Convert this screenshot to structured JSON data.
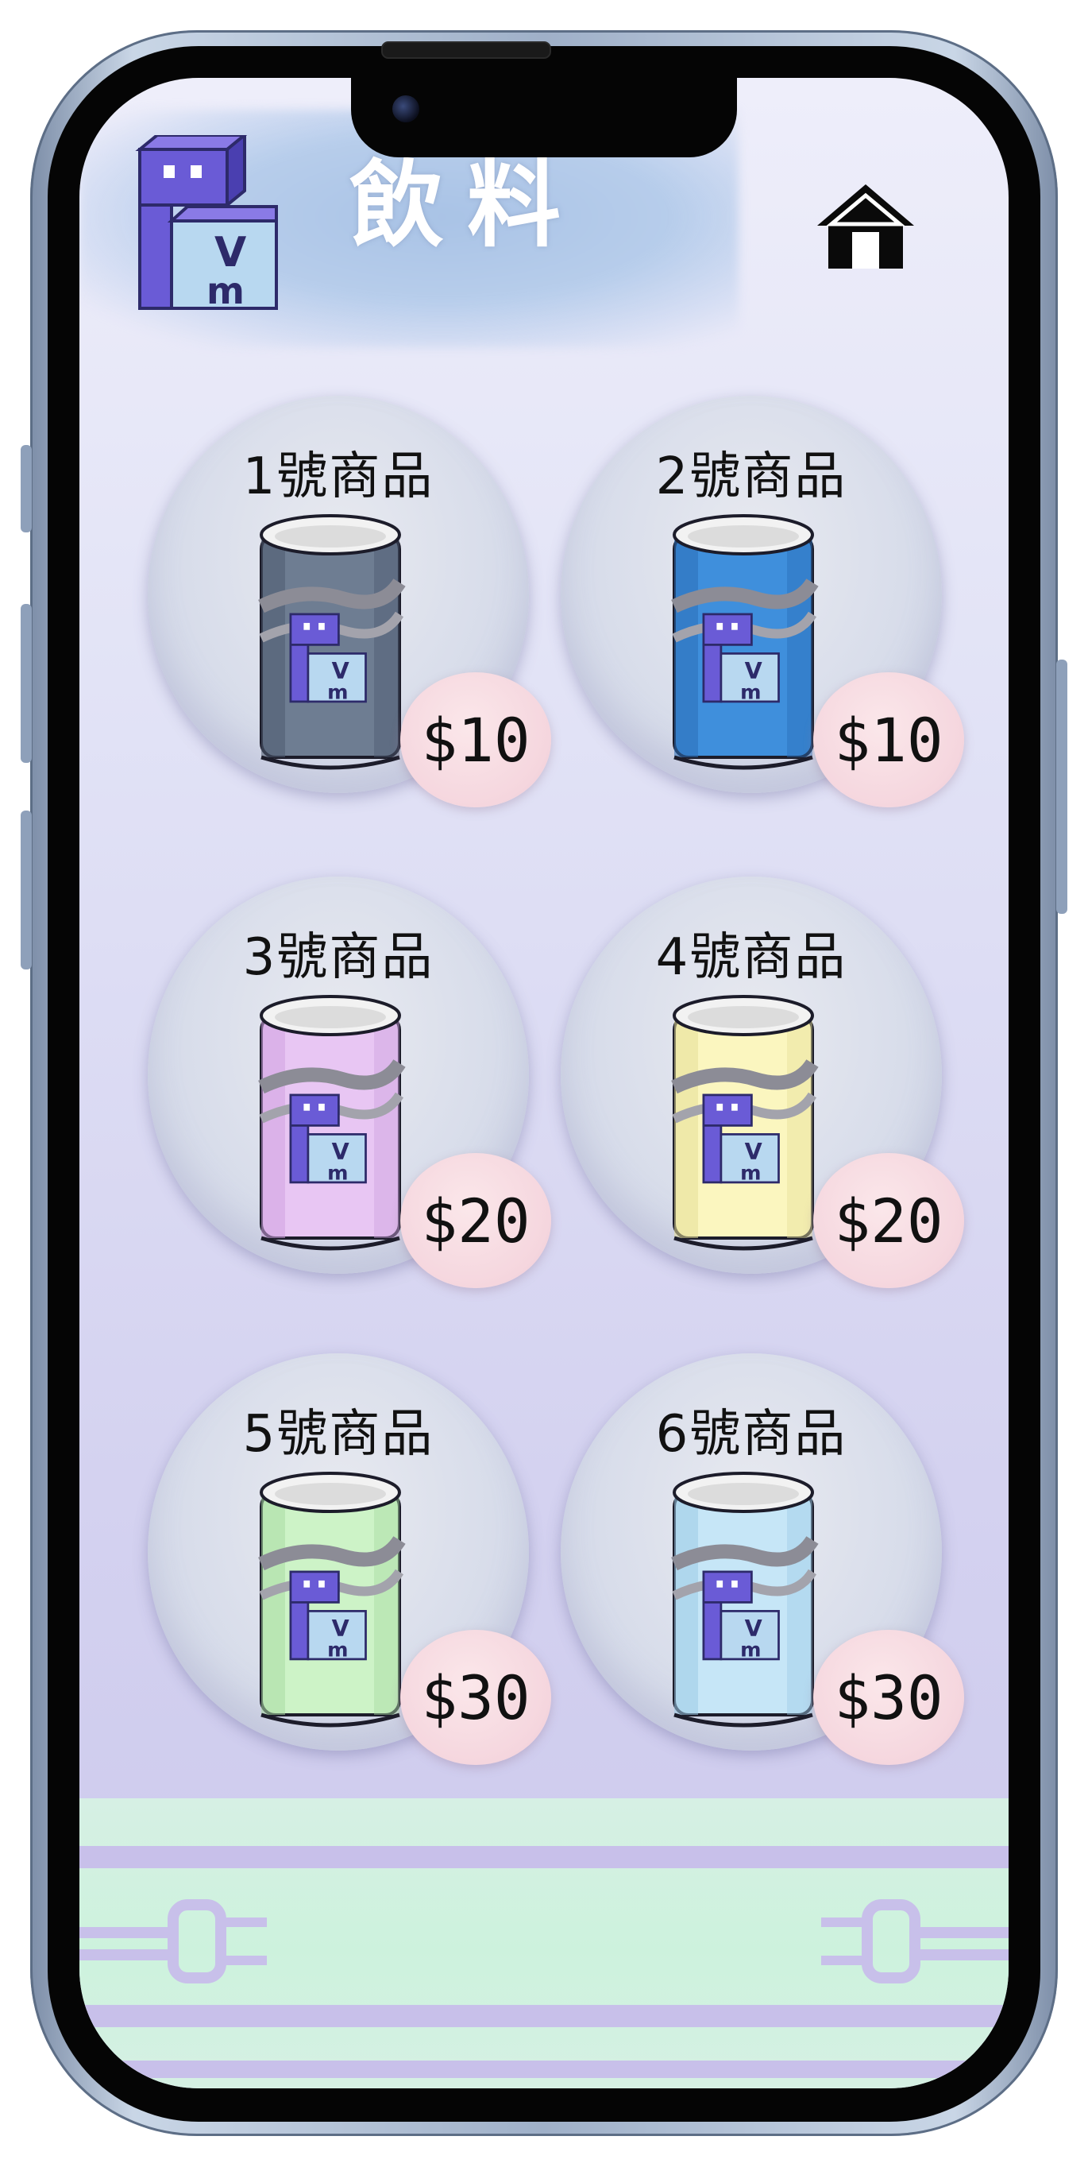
{
  "header": {
    "title": "飲料",
    "logo_icon": "vm-logo-icon",
    "home_icon": "home-icon"
  },
  "products": [
    {
      "label": "1號商品",
      "price": "$10",
      "can_color": "#6e7d92",
      "can_dark": "#4e5b70"
    },
    {
      "label": "2號商品",
      "price": "$10",
      "can_color": "#3f8fdc",
      "can_dark": "#2b6fb8"
    },
    {
      "label": "3號商品",
      "price": "$20",
      "can_color": "#e8c6f3",
      "can_dark": "#cfa2e0"
    },
    {
      "label": "4號商品",
      "price": "$20",
      "can_color": "#fbf6bf",
      "can_dark": "#e6df98"
    },
    {
      "label": "5號商品",
      "price": "$30",
      "can_color": "#cdf3c7",
      "can_dark": "#a9dba2"
    },
    {
      "label": "6號商品",
      "price": "$30",
      "can_color": "#c6e6f7",
      "can_dark": "#9dcbe6"
    }
  ],
  "footer": {
    "decoration_icon": "plug-icon"
  },
  "colors": {
    "background_top": "#eeeefa",
    "background_bottom": "#cbc8ec",
    "badge": "#f5d6de",
    "footer": "#cdf2dd",
    "stripe": "#c8c0ea"
  }
}
